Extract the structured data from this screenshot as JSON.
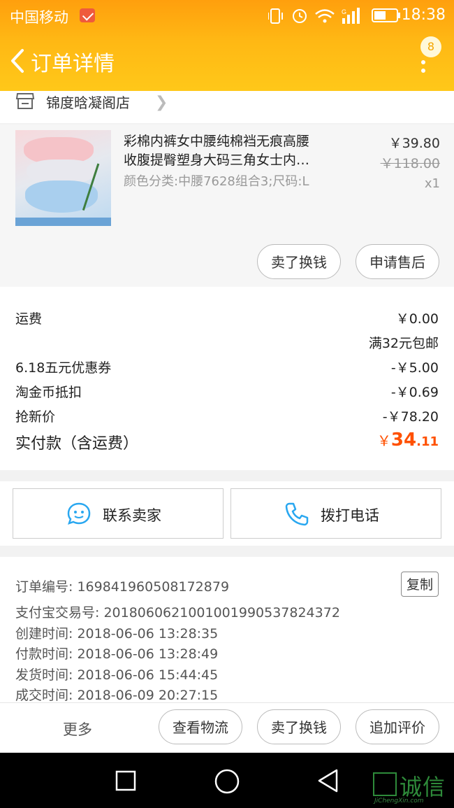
{
  "status_bar": {
    "carrier": "中国移动",
    "time": "18:38"
  },
  "header": {
    "title": "订单详情",
    "badge_count": "8"
  },
  "shop": {
    "name": "锦度晗凝阁店"
  },
  "product": {
    "title_line1": "彩棉内裤女中腰纯棉裆无痕高腰",
    "title_line2": "收腹提臀塑身大码三角女士内…",
    "sku": "颜色分类:中腰7628组合3;尺码:L",
    "price": "￥39.80",
    "original_price": "￥118.00",
    "quantity": "x1",
    "buttons": {
      "resell": "卖了换钱",
      "after_sale": "申请售后"
    }
  },
  "fees": {
    "shipping_label": "运费",
    "shipping_value": "￥0.00",
    "shipping_note": "满32元包邮",
    "coupon_label": "6.18五元优惠券",
    "coupon_value": "-￥5.00",
    "coins_label": "淘金币抵扣",
    "coins_value": "-￥0.69",
    "newbie_label": "抢新价",
    "newbie_value": "-￥78.20",
    "total_label": "实付款（含运费）",
    "total_currency": "￥",
    "total_integer": "34",
    "total_decimal": ".11"
  },
  "contact": {
    "seller": "联系卖家",
    "call": "拨打电话"
  },
  "order_info": {
    "order_no": "订单编号: 169841960508172879",
    "copy": "复制",
    "alipay_no": "支付宝交易号: 2018060621001001990537824372",
    "created": "创建时间: 2018-06-06 13:28:35",
    "paid": "付款时间: 2018-06-06 13:28:49",
    "shipped": "发货时间: 2018-06-06 15:44:45",
    "completed": "成交时间: 2018-06-09 20:27:15"
  },
  "actions": {
    "more": "更多",
    "logistics": "查看物流",
    "resell": "卖了换钱",
    "review": "追加评价"
  },
  "watermark": {
    "brand": "诚信",
    "url": "JiChengXin.com"
  },
  "colors": {
    "header_orange": "#ffb814",
    "price_orange": "#ff5000",
    "contact_blue": "#29a7f0"
  }
}
